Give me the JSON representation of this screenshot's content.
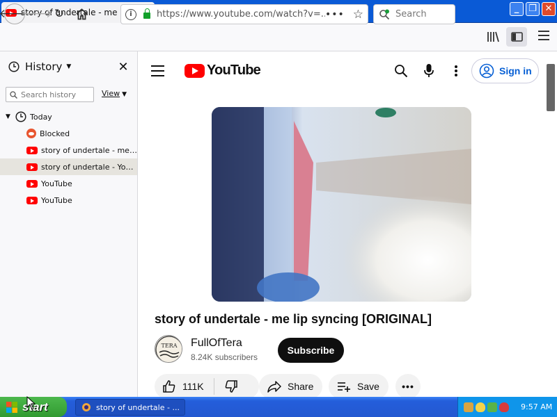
{
  "browser": {
    "tab_title": "story of undertale - me lip syncing",
    "url": "https://www.youtube.com/watch?v=...",
    "search_placeholder": "Search"
  },
  "sidebar": {
    "title": "History",
    "search_placeholder": "Search history",
    "view_label": "View",
    "group_label": "Today",
    "items": [
      {
        "label": "Blocked",
        "icon": "blocked-site-icon"
      },
      {
        "label": "story of undertale - me lip syncing",
        "icon": "youtube-favicon"
      },
      {
        "label": "story of undertale - YouTube",
        "icon": "youtube-favicon",
        "selected": true
      },
      {
        "label": "YouTube",
        "icon": "youtube-favicon"
      },
      {
        "label": "YouTube",
        "icon": "youtube-favicon"
      }
    ]
  },
  "youtube": {
    "logo_text": "YouTube",
    "signin_label": "Sign in",
    "video_title": "story of undertale - me lip syncing [ORIGINAL]",
    "channel_name": "FullOfTera",
    "subscribers": "8.24K subscribers",
    "subscribe_label": "Subscribe",
    "likes": "111K",
    "share_label": "Share",
    "save_label": "Save",
    "avatar_text": "TERA"
  },
  "taskbar": {
    "start_label": "start",
    "task_label": "story of undertale - ...",
    "clock": "9:57 AM"
  },
  "colors": {
    "xp_blue": "#245edb",
    "youtube_red": "#ff0000",
    "signin_blue": "#065fd4"
  }
}
